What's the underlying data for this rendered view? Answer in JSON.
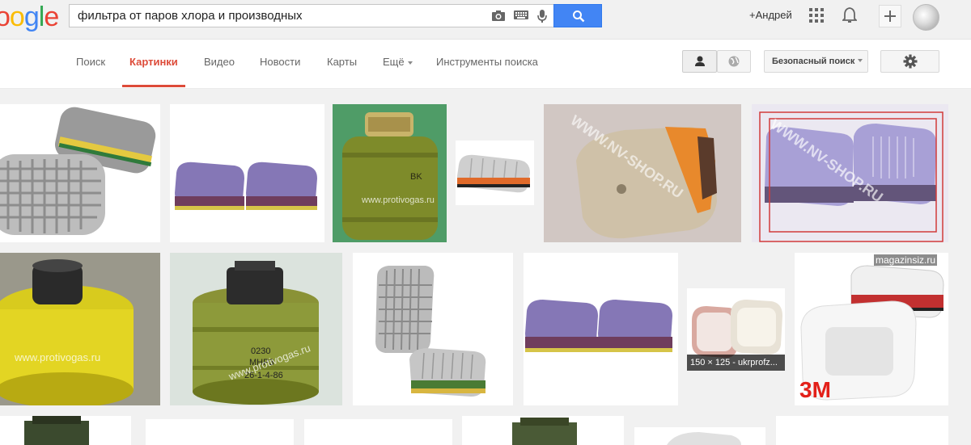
{
  "logo": {
    "text": "oogle"
  },
  "search": {
    "query": "фильтра от паров хлора и производных"
  },
  "header": {
    "user_label": "+Андрей"
  },
  "tabs": [
    {
      "label": "Поиск"
    },
    {
      "label": "Картинки"
    },
    {
      "label": "Видео"
    },
    {
      "label": "Новости"
    },
    {
      "label": "Карты"
    },
    {
      "label": "Ещё"
    },
    {
      "label": "Инструменты поиска"
    }
  ],
  "safe_search": {
    "label": "Безопасный поиск"
  },
  "images": {
    "watermark_protivogas": "www.protivogas.ru",
    "watermark_nvshop": "WWW.NV-SHOP.RU",
    "watermark_magazinsiz": "magazinsiz.ru",
    "caption_hover": "150 × 125 - ukrprofz...",
    "brand_3m": "3M",
    "text_bk": "BK",
    "text_can1": "0230",
    "text_can2": "МНР3",
    "text_can3": "26-1-4-86"
  },
  "colors": {
    "accent": "#4285f4",
    "active_tab": "#dd4b39",
    "topbar": "#f1f1f1"
  }
}
